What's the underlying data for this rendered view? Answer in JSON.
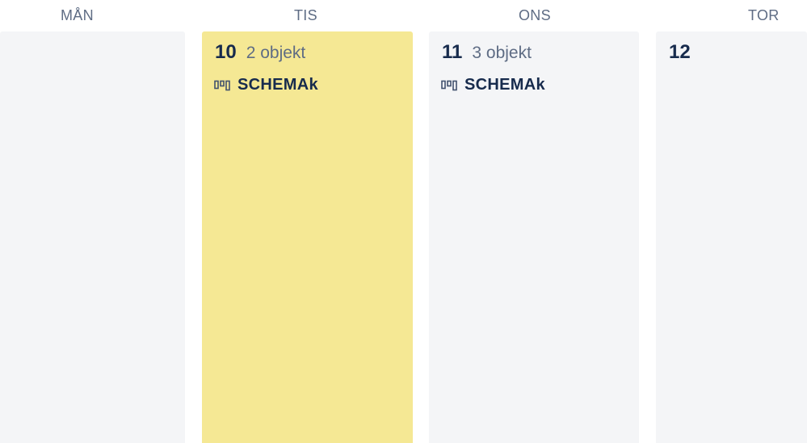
{
  "headers": {
    "mon": "MÅN",
    "tue": "TIS",
    "wed": "ONS",
    "thu": "TOR"
  },
  "days": {
    "tue": {
      "number": "10",
      "count": "2 objekt",
      "board_label": "SCHEMAk",
      "board_icon": "board-columns-icon"
    },
    "wed": {
      "number": "11",
      "count": "3 objekt",
      "board_label": "SCHEMAk",
      "board_icon": "board-columns-icon"
    },
    "thu": {
      "number": "12"
    }
  },
  "colors": {
    "highlight": "#f5e894",
    "column": "#f4f5f7",
    "text_primary": "#172b4d",
    "text_secondary": "#5e6c84"
  }
}
